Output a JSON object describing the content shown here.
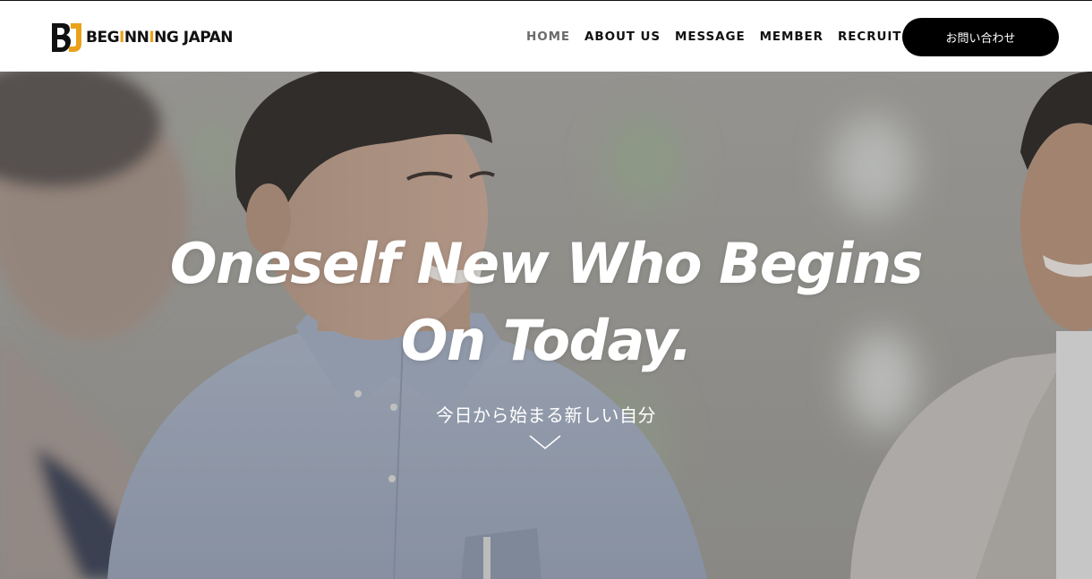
{
  "header": {
    "logo": {
      "mark": "BJ",
      "text_parts": [
        "BEG",
        "I",
        "NN",
        "I",
        "NG JAPAN"
      ]
    },
    "nav": [
      {
        "label": "HOME",
        "active": true
      },
      {
        "label": "ABOUT US",
        "active": false
      },
      {
        "label": "MESSAGE",
        "active": false
      },
      {
        "label": "MEMBER",
        "active": false
      },
      {
        "label": "RECRUIT",
        "active": false
      }
    ],
    "contact_button": "お問い合わせ"
  },
  "hero": {
    "title_line1": "Oneself New Who Begins",
    "title_line2": "On Today.",
    "subtitle": "今日から始まる新しい自分",
    "scroll_icon": "chevron-down-icon"
  },
  "colors": {
    "accent": "#e9a21a",
    "text": "#111111",
    "button_bg": "#000000",
    "nav_active": "#6b6b6b"
  }
}
